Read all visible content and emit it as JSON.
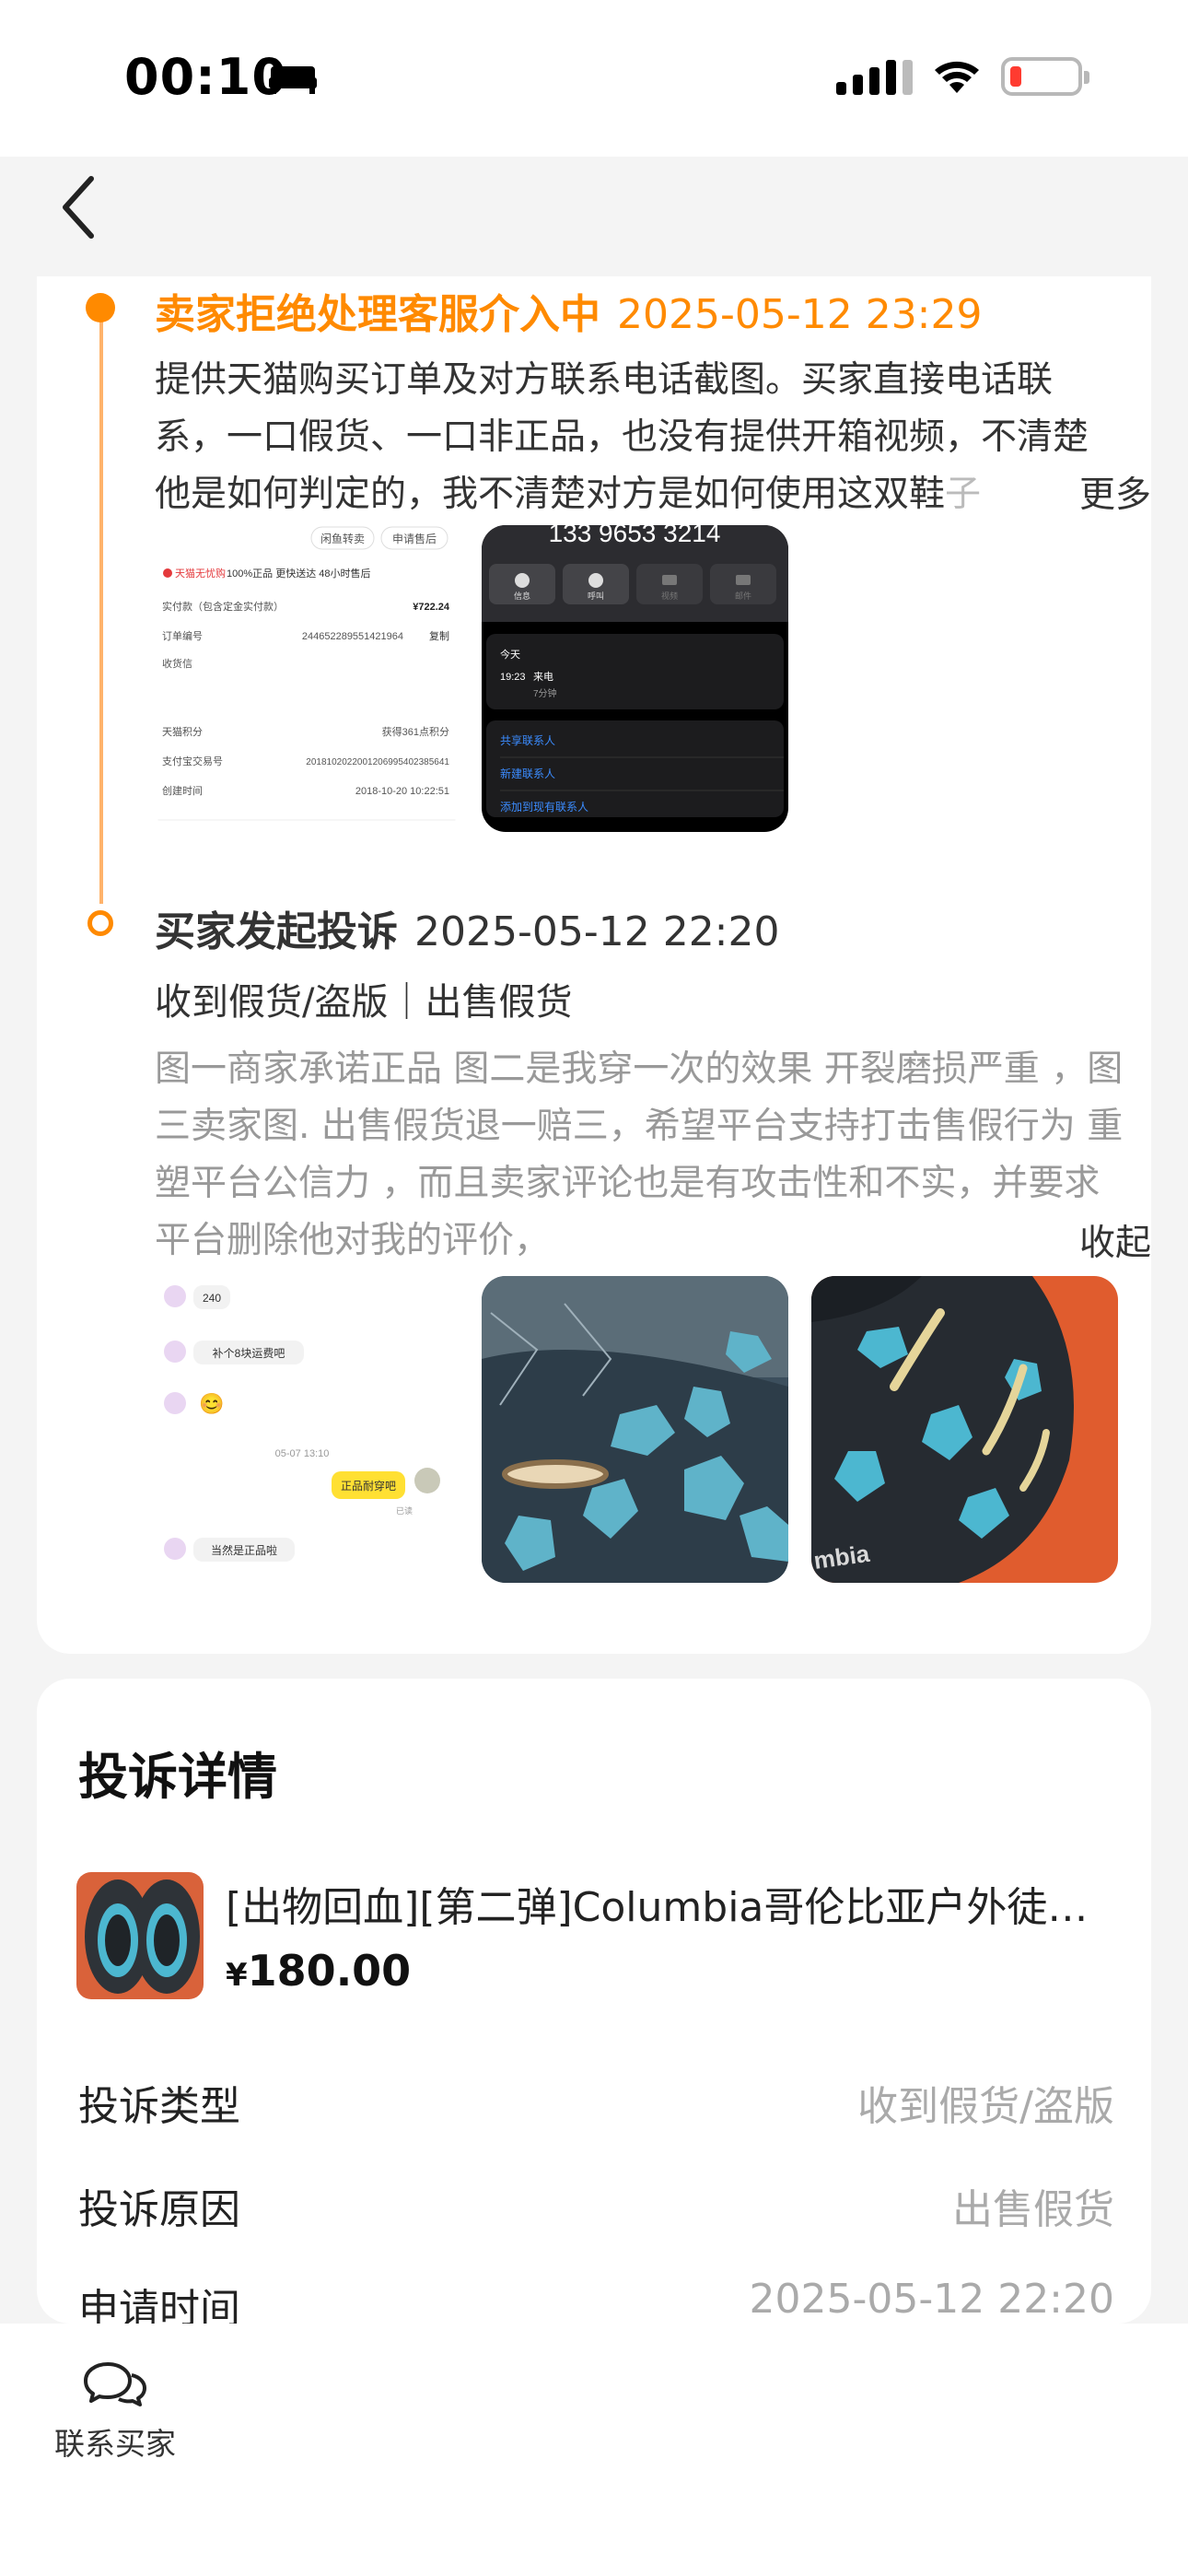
{
  "status_bar": {
    "time": "00:10"
  },
  "timeline": {
    "events": [
      {
        "title": "卖家拒绝处理客服介入中",
        "time": "2025-05-12 23:29",
        "text_main": "提供天猫购买订单及对方联系电话截图。买家直接电话联系，一口假货、一口非正品，也没有提供开箱视频，不清楚他是如何判定的，我不清楚对方是如何使用这双鞋",
        "text_fade": "子",
        "more_label": "更多"
      },
      {
        "title": "买家发起投诉",
        "time": "2025-05-12 22:20",
        "subtitle": "收到假货/盗版｜出售假货",
        "text": "图一商家承诺正品 图二是我穿一次的效果 开裂磨损严重 ，图三卖家图. 出售假货退一赔三，希望平台支持打击售假行为 重塑平台公信力 ，而且卖家评论也是有攻击性和不实，并要求平台删除他对我的评价，",
        "collapse_label": "收起"
      }
    ]
  },
  "order_screenshot": {
    "tab1": "闲鱼转卖",
    "tab2": "申请售后",
    "badge": "天猫无忧购",
    "promise": "100%正品 更快送达 48小时售后",
    "rows": [
      {
        "k": "实付款（包含定金实付款）",
        "v": "¥722.24"
      },
      {
        "k": "订单编号",
        "v": "2446522895514219​64"
      },
      {
        "k": "收货信",
        "v": ""
      },
      {
        "k": "天猫积分",
        "v": "获得361点积分"
      },
      {
        "k": "支付宝交易号",
        "v": "20181020220012069954023856​41"
      },
      {
        "k": "创建时间",
        "v": "2018-10-20 10:22:51"
      }
    ],
    "copy_label": "复制"
  },
  "call_screenshot": {
    "phone": "133 9653 3214",
    "actions": [
      "信息",
      "呼叫",
      "视频",
      "邮件"
    ],
    "today": "今天",
    "call_time": "19:23",
    "call_type": "来电",
    "duration": "7分钟",
    "links": [
      "共享联系人",
      "新建联系人",
      "添加到现有联系人"
    ]
  },
  "chat_screenshot": {
    "msg1": "240",
    "msg2": "补个8块运费吧",
    "emoji": "😊",
    "date": "05-07 13:10",
    "reply": "正品耐穿吧",
    "read": "已读",
    "msg3": "当然是正品啦"
  },
  "shoe_photo_brand": "mbia",
  "detail": {
    "title": "投诉详情",
    "product_name": "[出物回血][第二弹]Columbia哥伦比亚户外徒步鞋",
    "currency": "¥",
    "price": "180.00",
    "rows": [
      {
        "key": "投诉类型",
        "value": "收到假货/盗版"
      },
      {
        "key": "投诉原因",
        "value": "出售假货"
      },
      {
        "key": "申请时间",
        "value": "2025-05-12 22:20"
      }
    ]
  },
  "bottom": {
    "contact_label": "联系买家"
  },
  "colors": {
    "accent": "#ff8a00",
    "muted": "#999999"
  }
}
